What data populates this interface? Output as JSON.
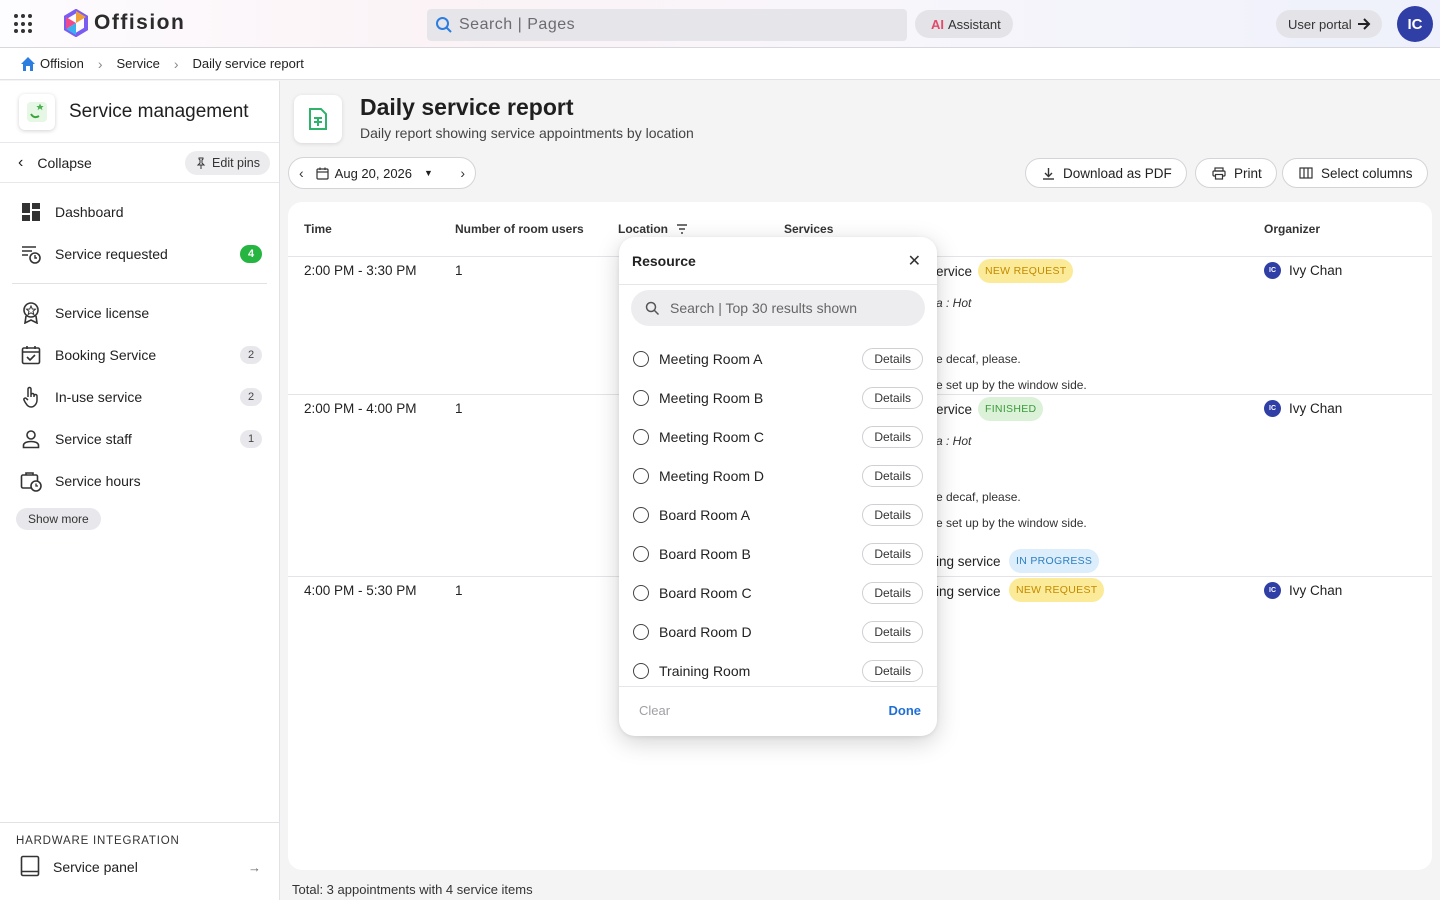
{
  "topbar": {
    "brand": "Offision",
    "search_placeholder": "Search | Pages",
    "ai_prefix": "AI",
    "ai_label": "Assistant",
    "portal_label": "User portal",
    "user_initials": "IC"
  },
  "breadcrumb": [
    "Offision",
    "Service",
    "Daily service report"
  ],
  "sidebar": {
    "title": "Service management",
    "collapse_label": "Collapse",
    "edit_pins_label": "Edit pins",
    "pinned": [
      {
        "label": "Dashboard",
        "icon": "dashboard-icon"
      },
      {
        "label": "Service requested",
        "icon": "service-requested-icon",
        "badge": "4"
      }
    ],
    "items": [
      {
        "label": "Service license",
        "icon": "license-badge-icon"
      },
      {
        "label": "Booking Service",
        "icon": "calendar-check-icon",
        "badge": "2"
      },
      {
        "label": "In-use service",
        "icon": "touch-icon",
        "badge": "2"
      },
      {
        "label": "Service staff",
        "icon": "person-icon",
        "badge": "1"
      },
      {
        "label": "Service hours",
        "icon": "briefcase-clock-icon"
      }
    ],
    "show_more": "Show more",
    "hardware_title": "HARDWARE INTEGRATION",
    "hardware_item": "Service panel"
  },
  "page": {
    "title": "Daily service report",
    "subtitle": "Daily report showing service appointments by location",
    "date": "Aug 20, 2026",
    "download_label": "Download as PDF",
    "print_label": "Print",
    "columns_label": "Select columns"
  },
  "table": {
    "headers": {
      "time": "Time",
      "users": "Number of room users",
      "location": "Location",
      "services": "Services",
      "organizer": "Organizer"
    },
    "rows": [
      {
        "time": "2:00 PM - 3:30 PM",
        "users": "1",
        "service": "ervice",
        "status": "NEW REQUEST",
        "note1": "a : Hot",
        "note2": "e decaf, please.",
        "note3": "e set up by the window side.",
        "organizer": "Ivy Chan",
        "org_initials": "IC"
      },
      {
        "time": "2:00 PM - 4:00 PM",
        "users": "1",
        "service": "ervice",
        "status": "FINISHED",
        "note1": "a : Hot",
        "note2": "e decaf, please.",
        "note3": "e set up by the window side.",
        "service2": "ing service",
        "status2": "IN PROGRESS",
        "organizer": "Ivy Chan",
        "org_initials": "IC"
      },
      {
        "time": "4:00 PM - 5:30 PM",
        "users": "1",
        "service": "ing service",
        "status": "NEW REQUEST",
        "organizer": "Ivy Chan",
        "org_initials": "IC"
      }
    ],
    "total": "Total: 3 appointments with 4 service items"
  },
  "popup": {
    "title": "Resource",
    "search_placeholder": "Search | Top 30 results shown",
    "details_label": "Details",
    "options": [
      "Meeting Room A",
      "Meeting Room B",
      "Meeting Room C",
      "Meeting Room D",
      "Board Room A",
      "Board Room B",
      "Board Room C",
      "Board Room D",
      "Training Room"
    ],
    "clear_label": "Clear",
    "done_label": "Done"
  }
}
